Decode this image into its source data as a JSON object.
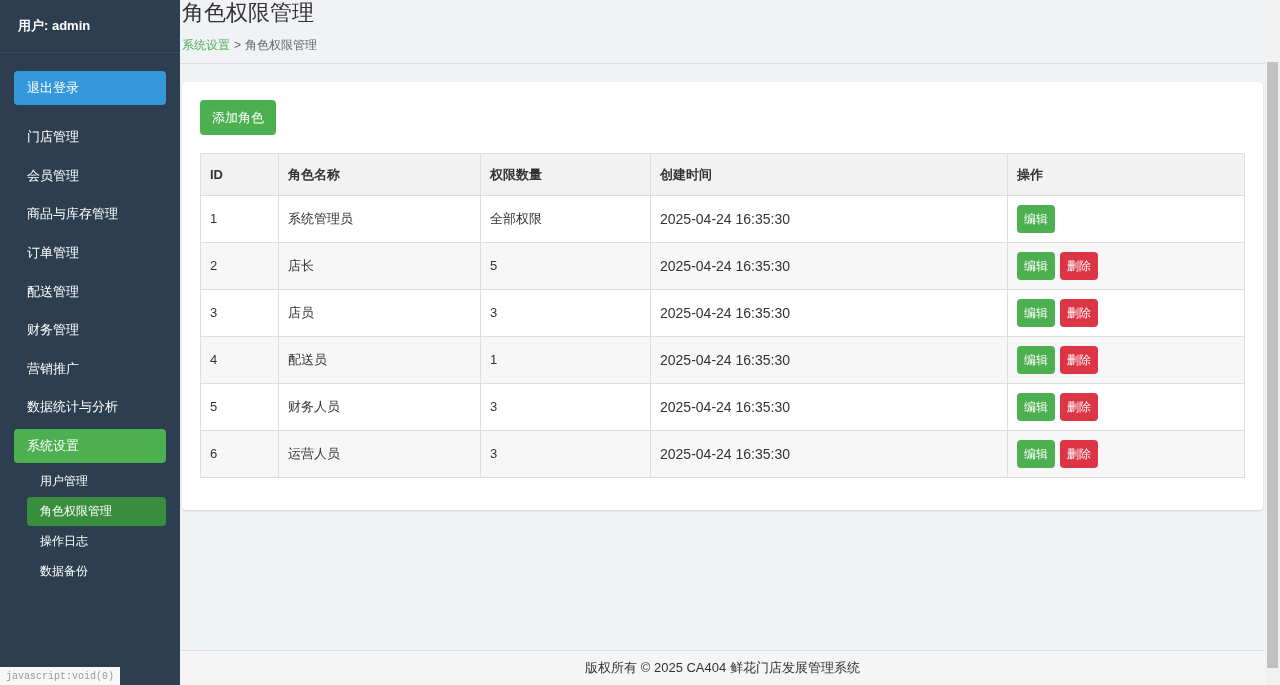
{
  "sidebar": {
    "user": "用户: admin",
    "logout": "退出登录",
    "items": [
      {
        "label": "门店管理",
        "selected": false
      },
      {
        "label": "会员管理",
        "selected": false
      },
      {
        "label": "商品与库存管理",
        "selected": false
      },
      {
        "label": "订单管理",
        "selected": false
      },
      {
        "label": "配送管理",
        "selected": false
      },
      {
        "label": "财务管理",
        "selected": false
      },
      {
        "label": "营销推广",
        "selected": false
      },
      {
        "label": "数据统计与分析",
        "selected": false
      },
      {
        "label": "系统设置",
        "selected": true,
        "children": [
          {
            "label": "用户管理",
            "selected": false
          },
          {
            "label": "角色权限管理",
            "selected": true
          },
          {
            "label": "操作日志",
            "selected": false
          },
          {
            "label": "数据备份",
            "selected": false
          }
        ]
      }
    ]
  },
  "page": {
    "title": "角色权限管理",
    "breadcrumb": [
      {
        "label": "系统设置",
        "kind": "link"
      },
      {
        "label": ">",
        "kind": "separator"
      },
      {
        "label": "角色权限管理",
        "kind": "current"
      }
    ]
  },
  "add_button": "添加角色",
  "table": {
    "columns": [
      "ID",
      "角色名称",
      "权限数量",
      "创建时间",
      "操作"
    ],
    "rows": [
      {
        "cells": [
          "1",
          "系统管理员",
          "全部权限",
          "2025-04-24 16:35:30"
        ],
        "actions": [
          "编辑"
        ]
      },
      {
        "cells": [
          "2",
          "店长",
          "5",
          "2025-04-24 16:35:30"
        ],
        "actions": [
          "编辑",
          "删除"
        ]
      },
      {
        "cells": [
          "3",
          "店员",
          "3",
          "2025-04-24 16:35:30"
        ],
        "actions": [
          "编辑",
          "删除"
        ]
      },
      {
        "cells": [
          "4",
          "配送员",
          "1",
          "2025-04-24 16:35:30"
        ],
        "actions": [
          "编辑",
          "删除"
        ]
      },
      {
        "cells": [
          "5",
          "财务人员",
          "3",
          "2025-04-24 16:35:30"
        ],
        "actions": [
          "编辑",
          "删除"
        ]
      },
      {
        "cells": [
          "6",
          "运营人员",
          "3",
          "2025-04-24 16:35:30"
        ],
        "actions": [
          "编辑",
          "删除"
        ]
      }
    ]
  },
  "footer": "版权所有 © 2025 CA404 鲜花门店发展管理系统",
  "status_bar": "javascript:void(0)"
}
